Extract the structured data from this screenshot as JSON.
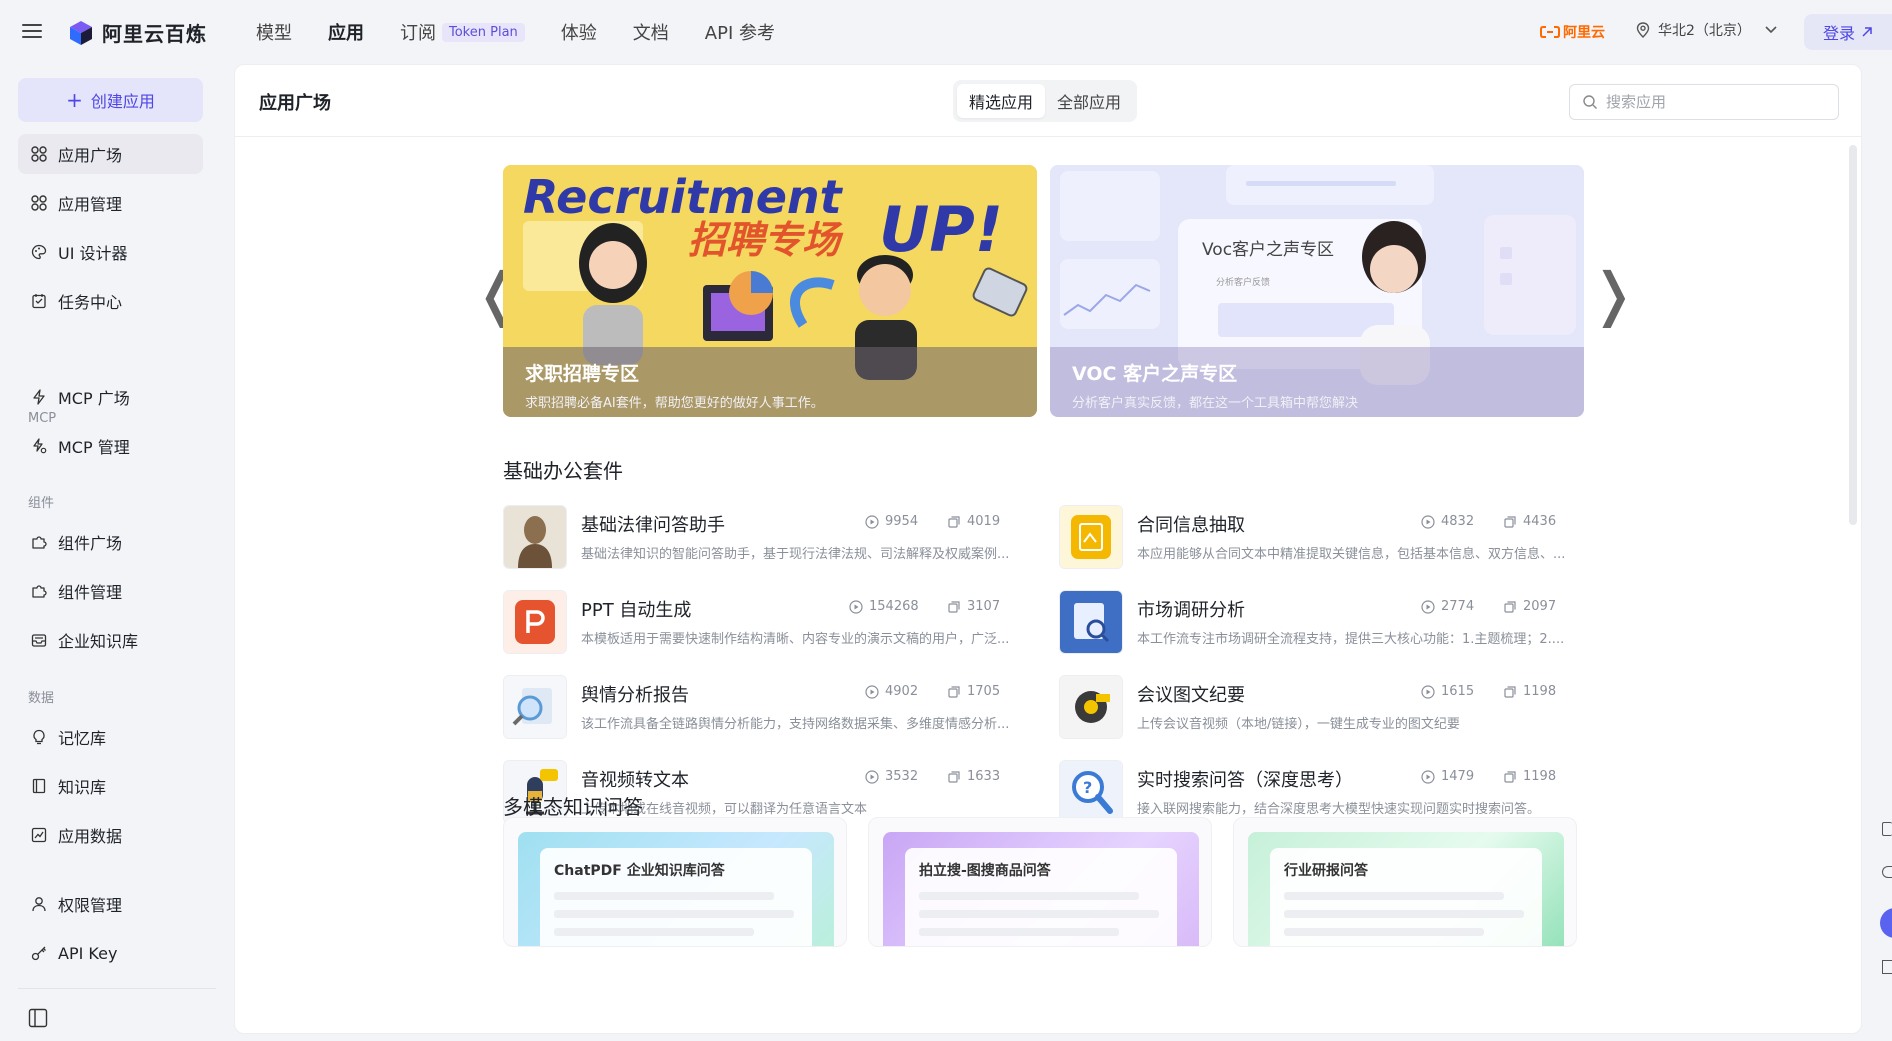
{
  "topbar": {
    "brand": "阿里云百炼",
    "nav": [
      {
        "label": "模型",
        "active": false
      },
      {
        "label": "应用",
        "active": true
      },
      {
        "label": "订阅",
        "active": false,
        "badge": "Token Plan"
      },
      {
        "label": "体验",
        "active": false
      },
      {
        "label": "文档",
        "active": false
      },
      {
        "label": "API 参考",
        "active": false
      }
    ],
    "aliyun_label": "阿里云",
    "region": "华北2（北京）",
    "login": "登录"
  },
  "sidebar": {
    "create_label": "创建应用",
    "items": [
      {
        "label": "应用广场",
        "icon": "grid-icon",
        "active": true
      },
      {
        "label": "应用管理",
        "icon": "grid-icon"
      },
      {
        "label": "UI 设计器",
        "icon": "palette-icon"
      },
      {
        "label": "任务中心",
        "icon": "task-icon"
      },
      {
        "label": "MCP 广场",
        "icon": "mcp-icon"
      },
      {
        "label": "MCP 管理",
        "icon": "mcp-manage-icon"
      },
      {
        "label": "组件广场",
        "icon": "puzzle-icon"
      },
      {
        "label": "组件管理",
        "icon": "puzzle-icon"
      },
      {
        "label": "企业知识库",
        "icon": "inbox-icon"
      },
      {
        "label": "记忆库",
        "icon": "bulb-icon"
      },
      {
        "label": "知识库",
        "icon": "book-icon"
      },
      {
        "label": "应用数据",
        "icon": "chart-icon"
      },
      {
        "label": "权限管理",
        "icon": "user-icon"
      },
      {
        "label": "API Key",
        "icon": "key-icon"
      }
    ],
    "groups": [
      "MCP",
      "组件",
      "数据"
    ]
  },
  "main": {
    "title": "应用广场",
    "tabs": [
      {
        "label": "精选应用",
        "active": true
      },
      {
        "label": "全部应用",
        "active": false
      }
    ],
    "search_placeholder": "搜索应用",
    "banners": [
      {
        "art_title": "Recruitment",
        "art_title_2": "UP!",
        "art_sub": "招聘专场",
        "title": "求职招聘专区",
        "subtitle": "求职招聘必备AI套件，帮助您更好的做好人事工作。"
      },
      {
        "art_title": "Voc客户之声专区",
        "art_sub": "分析客户反馈",
        "title": "VOC 客户之声专区",
        "subtitle": "分析客户真实反馈，都在这一个工具箱中帮您解决"
      }
    ],
    "section1_title": "基础办公套件",
    "apps": [
      {
        "name": "基础法律问答助手",
        "desc": "基础法律知识的智能问答助手，基于现行法律法规、司法解释及权威案例...",
        "views": "9954",
        "copies": "4019",
        "icon": "statue-icon",
        "color": "#8b6f4e"
      },
      {
        "name": "合同信息抽取",
        "desc": "本应用能够从合同文本中精准提取关键信息，包括基本信息、双方信息、...",
        "views": "4832",
        "copies": "4436",
        "icon": "contract-icon",
        "color": "#f5b800"
      },
      {
        "name": "PPT 自动生成",
        "desc": "本模板适用于需要快速制作结构清晰、内容专业的演示文稿的用户，广泛...",
        "views": "154268",
        "copies": "3107",
        "icon": "ppt-icon",
        "color": "#e5532f"
      },
      {
        "name": "市场调研分析",
        "desc": "本工作流专注市场调研全流程支持，提供三大核心功能：1.主题梳理；2....",
        "views": "2774",
        "copies": "2097",
        "icon": "research-icon",
        "color": "#3f6fc4"
      },
      {
        "name": "舆情分析报告",
        "desc": "该工作流具备全链路舆情分析能力，支持网络数据采集、多维度情感分析...",
        "views": "4902",
        "copies": "1705",
        "icon": "magnifier-report-icon",
        "color": "#5b9bd5"
      },
      {
        "name": "会议图文纪要",
        "desc": "上传会议音视频（本地/链接），一键生成专业的图文纪要",
        "views": "1615",
        "copies": "1198",
        "icon": "tape-icon",
        "color": "#3a3a3a"
      },
      {
        "name": "音视频转文本",
        "desc": "上传本地或在线音视频，可以翻译为任意语言文本",
        "views": "3532",
        "copies": "1633",
        "icon": "microphone-icon",
        "color": "#2f3e5c"
      },
      {
        "name": "实时搜索问答（深度思考）",
        "desc": "接入联网搜索能力，结合深度思考大模型快速实现问题实时搜索问答。",
        "views": "1479",
        "copies": "1198",
        "icon": "search-question-icon",
        "color": "#3a7bd5"
      }
    ],
    "section2_title": "多模态知识问答",
    "mm_cards": [
      {
        "title": "ChatPDF 企业知识库问答",
        "bg": "linear-gradient(135deg,#9fe0f0,#c7e8ff 60%,#b9f0d8)"
      },
      {
        "title": "拍立搜-图搜商品问答",
        "bg": "linear-gradient(135deg,#c9a6f5,#e6d4ff 60%,#d7b8f7)"
      },
      {
        "title": "行业研报问答",
        "bg": "linear-gradient(135deg,#c6f0d9,#e6fbee 55%,#8ee0b6)"
      }
    ]
  }
}
